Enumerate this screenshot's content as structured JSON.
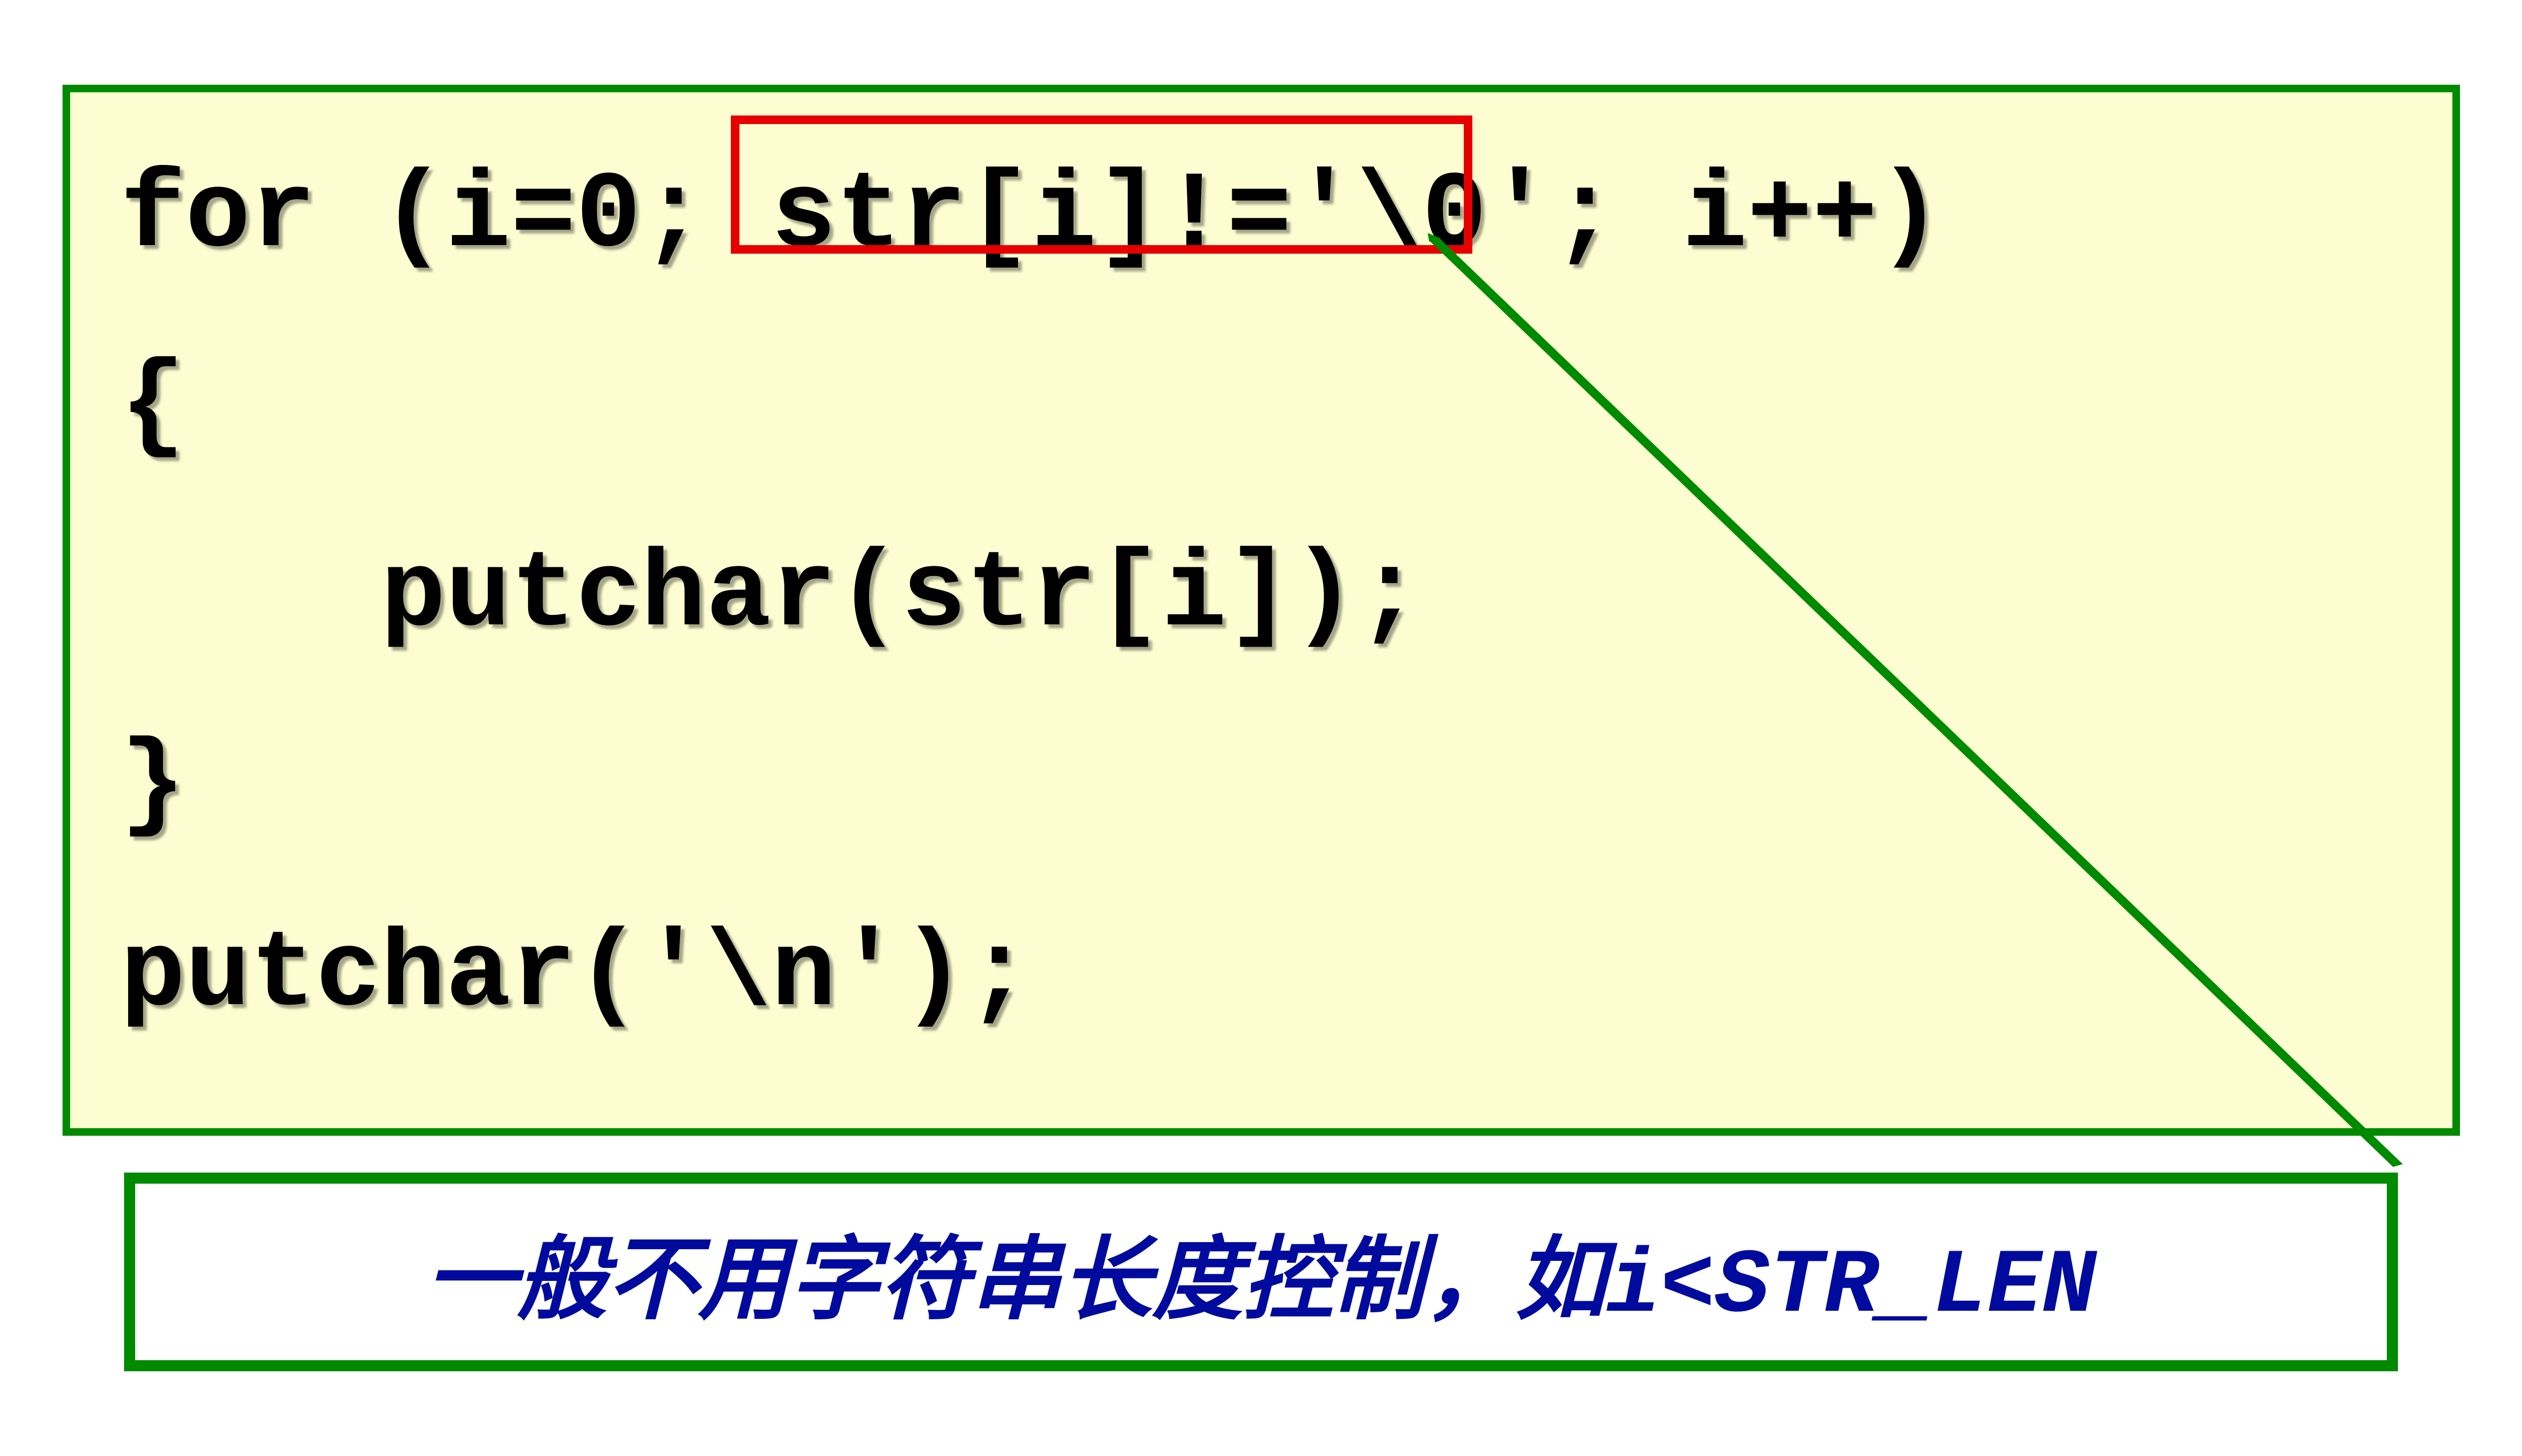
{
  "code": {
    "line1_pre": "for (i=0; ",
    "line1_highlight": "str[i]!='\\0'",
    "line1_post": "; i++)",
    "line2": "{",
    "line3": "    putchar(str[i]);",
    "line4": "}",
    "line5": "putchar('\\n');"
  },
  "note": {
    "text_cn": "一般不用字符串长度控制，如",
    "text_code": "i<STR_LEN"
  }
}
